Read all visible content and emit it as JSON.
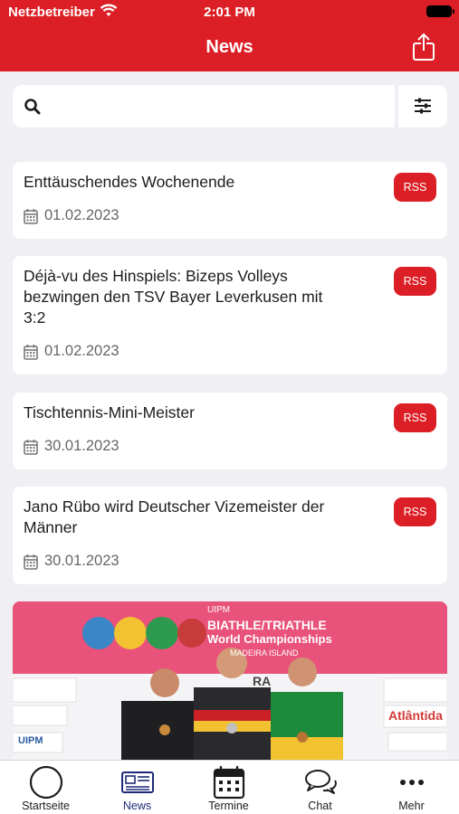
{
  "status_bar": {
    "carrier": "Netzbetreiber",
    "time": "2:01 PM"
  },
  "header": {
    "title": "News",
    "share_icon": "share-icon"
  },
  "search": {
    "placeholder": "",
    "value": "",
    "icon": "search-icon",
    "filter_icon": "sliders-icon"
  },
  "news": [
    {
      "title": "Enttäuschendes Wochenende",
      "date": "01.02.2023",
      "badge": "RSS"
    },
    {
      "title": "Déjà-vu des Hinspiels: Bizeps Volleys bezwingen den TSV Bayer Leverkusen mit 3:2",
      "date": "01.02.2023",
      "badge": "RSS"
    },
    {
      "title": "Tischtennis-Mini-Meister",
      "date": "30.01.2023",
      "badge": "RSS"
    },
    {
      "title": "Jano Rübo wird Deutscher Vizemeister der Männer",
      "date": "30.01.2023",
      "badge": "RSS"
    }
  ],
  "image_card": {
    "banner_lines": [
      "UIPM",
      "BIATHLE/TRIATHLE",
      "World Championships",
      "MADEIRA ISLAND"
    ],
    "sponsors": [
      "Atlântida",
      "RA",
      "UIPM"
    ]
  },
  "tabs": [
    {
      "label": "Startseite",
      "icon": "home-circle-icon"
    },
    {
      "label": "News",
      "icon": "newspaper-icon"
    },
    {
      "label": "Termine",
      "icon": "calendar-icon"
    },
    {
      "label": "Chat",
      "icon": "chat-bubbles-icon"
    },
    {
      "label": "Mehr",
      "icon": "more-dots-icon"
    }
  ],
  "colors": {
    "brand_red": "#dc1f26",
    "active_tab": "#1e2a78",
    "background": "#efeff4"
  }
}
